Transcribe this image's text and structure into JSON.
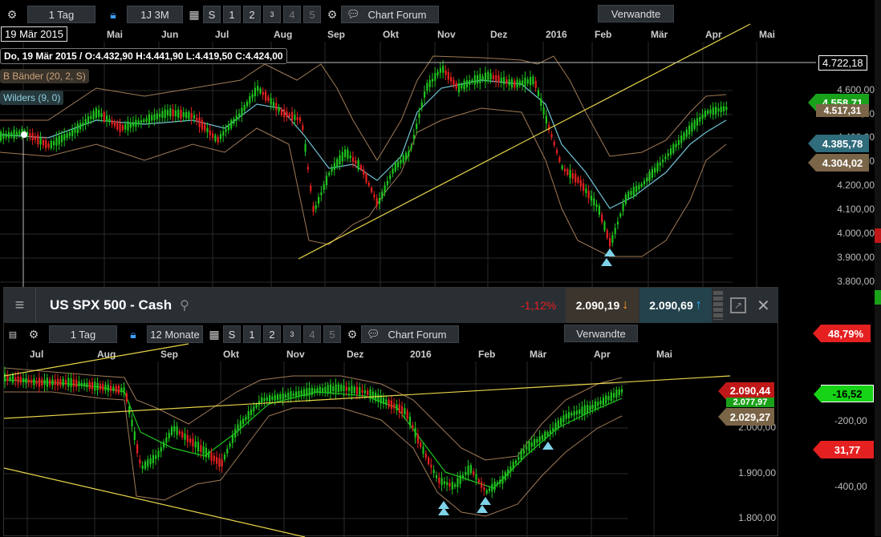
{
  "top": {
    "toolbar": {
      "interval": "1 Tag",
      "range": "1J 3M",
      "s_label": "S",
      "n1": "1",
      "n2": "2",
      "n3": "3",
      "n4": "4",
      "n5": "5",
      "chart_forum": "Chart Forum",
      "verwandte": "Verwandte"
    },
    "date_box": "19 Mär 2015",
    "months": [
      "Mai",
      "Jun",
      "Jul",
      "Aug",
      "Sep",
      "Okt",
      "Nov",
      "Dez",
      "2016",
      "Feb",
      "Mär",
      "Apr",
      "Mai"
    ],
    "ohlc": "Do, 19 Mär 2015 / O:4.432,90  H:4.441,90  L:4.419,50  C:4.424,00",
    "legend1": "B Bänder (20, 2, S)",
    "legend2": "Wilders (9, 0)",
    "crosshair_value": "4.722,18",
    "y_ticks": [
      "4.600,00",
      "4.500,00",
      "4.400,00",
      "4.300,00",
      "4.200,00",
      "4.100,00",
      "4.000,00",
      "3.900,00",
      "3.800,00"
    ],
    "tags": {
      "price": "4.558,71",
      "upper": "4.517,31",
      "ma": "4.385,78",
      "lower": "4.304,02"
    }
  },
  "bottom": {
    "title": "US SPX 500 - Cash",
    "change": "-1,12%",
    "bid": "2.090,19",
    "ask": "2.090,69",
    "toolbar": {
      "interval": "1 Tag",
      "range": "12 Monate",
      "s_label": "S",
      "n1": "1",
      "n2": "2",
      "n3": "3",
      "n4": "4",
      "n5": "5",
      "chart_forum": "Chart Forum",
      "verwandte": "Verwandte"
    },
    "months": [
      "Jul",
      "Aug",
      "Sep",
      "Okt",
      "Nov",
      "Dez",
      "2016",
      "Feb",
      "Mär",
      "Apr",
      "Mai"
    ],
    "y_ticks": [
      "2.000,00",
      "1.900,00",
      "1.800,00"
    ],
    "tags": {
      "price": "2.090,44",
      "upper": "2.077,97",
      "lower": "2.029,27"
    }
  },
  "right_panel": {
    "tags": [
      "48,79%",
      "-16,52",
      "31,77"
    ],
    "ticks": [
      "-200,00",
      "-400,00"
    ]
  },
  "colors": {
    "up": "#1ec51e",
    "down": "#e52020",
    "band": "#a07a55",
    "ma": "#6fc3d6",
    "trend": "#e8d44a",
    "tag_green": "#1aa11a",
    "tag_red": "#c01818",
    "tag_teal": "#2f6c7c",
    "tag_brown": "#7a6548"
  }
}
